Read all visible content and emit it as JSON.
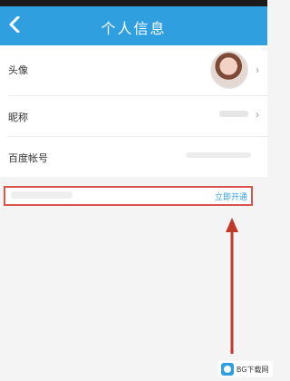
{
  "header": {
    "title": "个人信息",
    "background": "#2f9fe0",
    "back_icon": "chevron-left-icon"
  },
  "profile": {
    "rows": [
      {
        "label": "头像"
      },
      {
        "label": "昵称"
      },
      {
        "label": "百度帐号"
      }
    ]
  },
  "phone_binding": {
    "action_label": "立即开通",
    "accent": "#2f9fe0",
    "highlight": "#d9534f"
  },
  "watermark": {
    "text": "BG下载网"
  }
}
